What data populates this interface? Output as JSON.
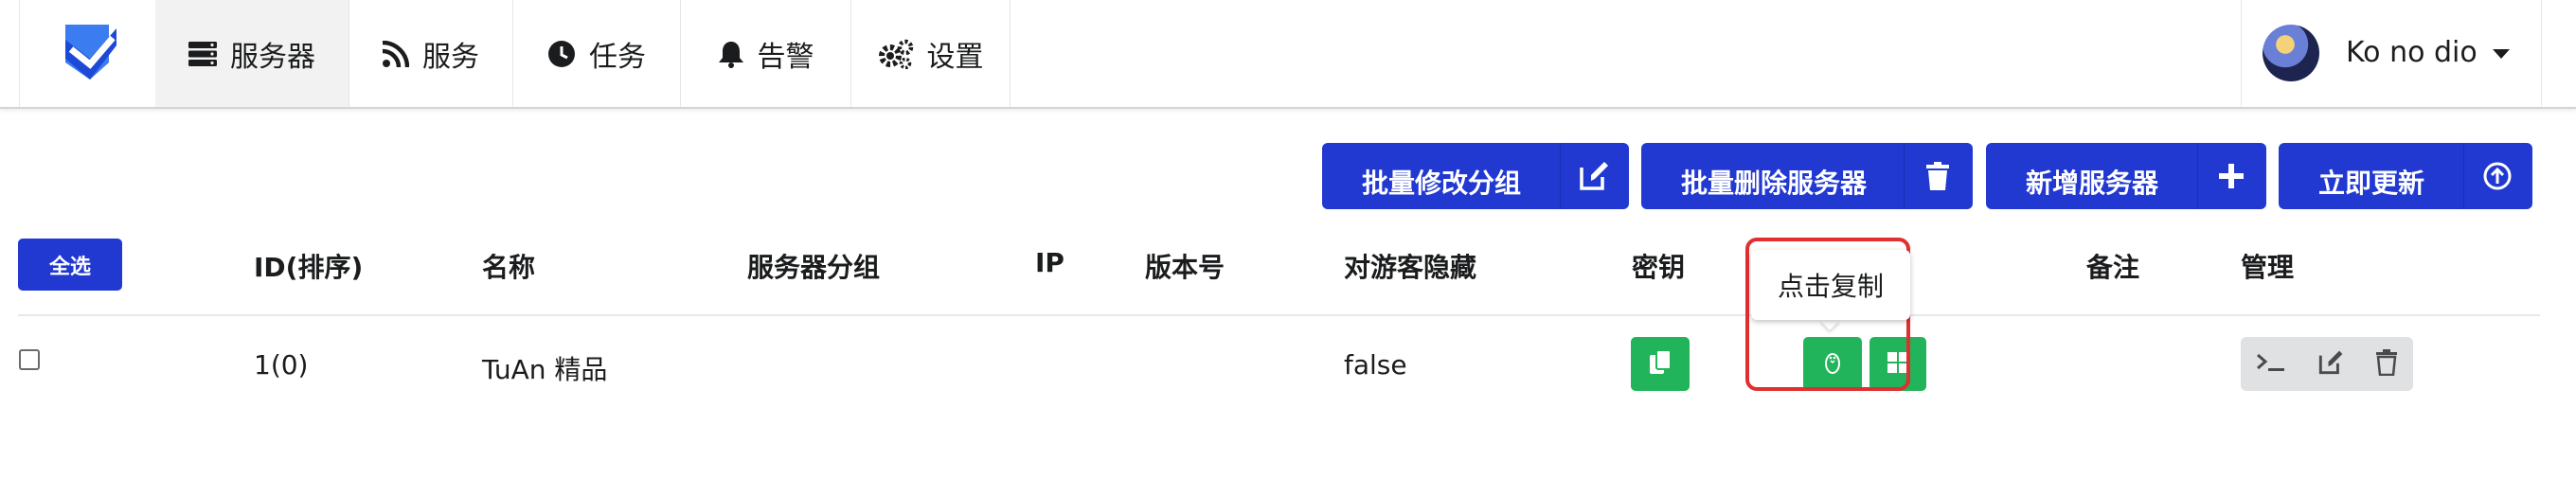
{
  "nav": {
    "items": [
      {
        "label": "服务器",
        "icon": "server-icon"
      },
      {
        "label": "服务",
        "icon": "rss-icon"
      },
      {
        "label": "任务",
        "icon": "clock-icon"
      },
      {
        "label": "告警",
        "icon": "bell-icon"
      },
      {
        "label": "设置",
        "icon": "cogs-icon"
      }
    ],
    "user": {
      "name": "Ko no dio"
    }
  },
  "actions": {
    "batch_group": "批量修改分组",
    "batch_delete": "批量删除服务器",
    "add_server": "新增服务器",
    "update_now": "立即更新"
  },
  "table": {
    "select_all": "全选",
    "headers": {
      "id": "ID(排序)",
      "name": "名称",
      "group": "服务器分组",
      "ip": "IP",
      "version": "版本号",
      "hide": "对游客隐藏",
      "secret": "密钥",
      "note": "备注",
      "manage": "管理"
    },
    "rows": [
      {
        "id": "1(0)",
        "name": "TuAn 精品",
        "group": "",
        "ip": "",
        "version": "",
        "hide": "false",
        "note": ""
      }
    ],
    "tooltip": "点击复制"
  },
  "colors": {
    "primary": "#2139d1",
    "success": "#22b45a",
    "highlight": "#e02f2f"
  }
}
